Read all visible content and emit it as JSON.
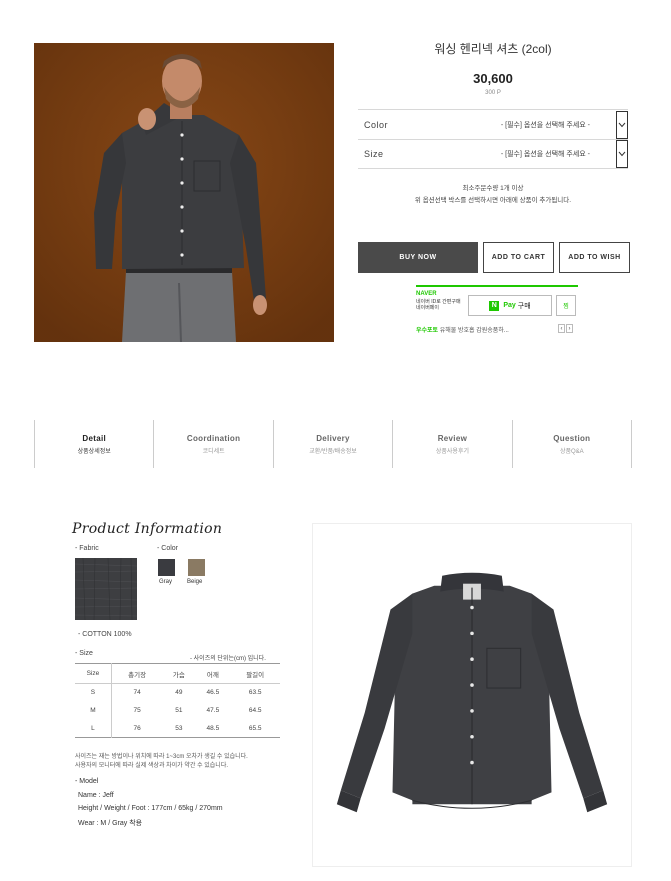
{
  "product": {
    "title": "워싱 헨리넥 셔츠 (2col)",
    "price": "30,600",
    "points": "300 P"
  },
  "options": [
    {
      "label": "Color",
      "value": "- [필수] 옵션을 선택해 주세요 -"
    },
    {
      "label": "Size",
      "value": "- [필수] 옵션을 선택해 주세요 -"
    }
  ],
  "notice": {
    "line1": "최소주문수량 1개 이상",
    "line2": "위 옵션선택 박스를 선택하시면 아래에 상품이 추가됩니다."
  },
  "buttons": {
    "buy": "BUY NOW",
    "cart": "ADD TO CART",
    "wish": "ADD TO WISH"
  },
  "naver": {
    "brand": "NAVER",
    "sub1": "네이버 ID로 간편구매",
    "sub2": "네이버페이",
    "logo": "N",
    "pay": "Pay",
    "pay_label": "구매",
    "zzim": "찜",
    "link_em": "우수포토",
    "link_rest": " 유해물 방호흡 감원송품하...",
    "prev": "‹",
    "next": "›"
  },
  "tabs": [
    {
      "en": "Detail",
      "ko": "상품상세정보",
      "active": true
    },
    {
      "en": "Coordination",
      "ko": "코디세트",
      "active": false
    },
    {
      "en": "Delivery",
      "ko": "교환/반품/배송정보",
      "active": false
    },
    {
      "en": "Review",
      "ko": "상품사용후기",
      "active": false
    },
    {
      "en": "Question",
      "ko": "상품Q&A",
      "active": false
    }
  ],
  "detail": {
    "heading": "Product Information",
    "fabric_label": "- Fabric",
    "color_label": "- Color",
    "colors": [
      {
        "name": "Gray",
        "hex": "#3a3b40"
      },
      {
        "name": "Beige",
        "hex": "#8a7a63"
      }
    ],
    "composition": "- COTTON 100%",
    "size_label": "- Size",
    "size_unit": "- 사이즈의 단위는(cm) 입니다.",
    "size_table": {
      "headers": [
        "Size",
        "총기장",
        "가슴",
        "어깨",
        "팔길이"
      ],
      "rows": [
        [
          "S",
          "74",
          "49",
          "46.5",
          "63.5"
        ],
        [
          "M",
          "75",
          "51",
          "47.5",
          "64.5"
        ],
        [
          "L",
          "76",
          "53",
          "48.5",
          "65.5"
        ]
      ]
    },
    "size_note1": "사이즈는 재는 방법이나 위치에 따라 1~3cm 오차가 생길 수 있습니다.",
    "size_note2": "사용자의 모니터에 따라 실제 색상과 차이가 약간 수 있습니다.",
    "model_label": "- Model",
    "model_name": "Name : Jeff",
    "model_body": "Height / Weight / Foot : 177cm / 65kg / 270mm",
    "model_wear": "Wear : M / Gray 착용"
  }
}
